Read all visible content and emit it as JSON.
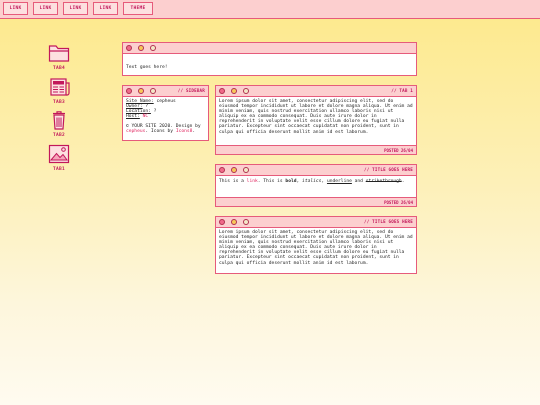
{
  "nav": [
    "LINK",
    "LINK",
    "LINK",
    "LINK",
    "THEME"
  ],
  "side_tabs": [
    {
      "label": "TAB4",
      "icon": "folder-icon"
    },
    {
      "label": "TAB3",
      "icon": "newspaper-icon"
    },
    {
      "label": "TAB2",
      "icon": "trash-icon"
    },
    {
      "label": "TAB1",
      "icon": "picture-icon"
    }
  ],
  "intro": {
    "text": "Text goes here!"
  },
  "sidebar": {
    "title": "// SIDEBAR",
    "site_name_label": "Site Name:",
    "site_name": " cepheus",
    "owner_label": "Owner:",
    "owner": " ?",
    "location_label": "Location:",
    "location": " ?",
    "host_label": "Host:",
    "host": " NC",
    "footer_prefix": "© YOUR SITE 2020. Design by ",
    "footer_author": "cepheus",
    "footer_mid": ". Icons by ",
    "footer_icons": "Icons8",
    "footer_end": "."
  },
  "tab1": {
    "title": "// TAB 1",
    "body": "Lorem ipsum dolor sit amet, consectetur adipiscing elit, sed do eiusmod tempor incididunt ut labore et dolore magna aliqua. Ut enim ad minim veniam, quis nostrud exercitation ullamco laboris nisi ut aliquip ex ea commodo consequat. Duis aute irure dolor in reprehenderit in voluptate velit esse cillum dolore eu fugiat nulla pariatur. Excepteur sint occaecat cupidatat non proident, sunt in culpa qui officia deserunt mollit anim id est laborum.",
    "posted": "POSTED 26/04"
  },
  "post2": {
    "title": "// TITLE GOES HERE",
    "t1": "This is a ",
    "link": "link",
    "t2": ". This is ",
    "bold": "bold",
    "t3": ", ",
    "italics": "italics",
    "t4": ", ",
    "underline": "underline",
    "t5": " and ",
    "strike": "strikethrough",
    "t6": ".",
    "posted": "POSTED 26/04"
  },
  "post3": {
    "title": "// TITLE GOES HERE",
    "body": "Lorem ipsum dolor sit amet, consectetur adipiscing elit, sed do eiusmod tempor incididunt ut labore et dolore magna aliqua. Ut enim ad minim veniam, quis nostrud exercitation ullamco laboris nisi ut aliquip ex ea commodo consequat. Duis aute irure dolor in reprehenderit in voluptate velit esse cillum dolore eu fugiat nulla pariatur. Excepteur sint occaecat cupidatat non proident, sunt in culpa qui officia deserunt mollit anim id est laborum."
  }
}
